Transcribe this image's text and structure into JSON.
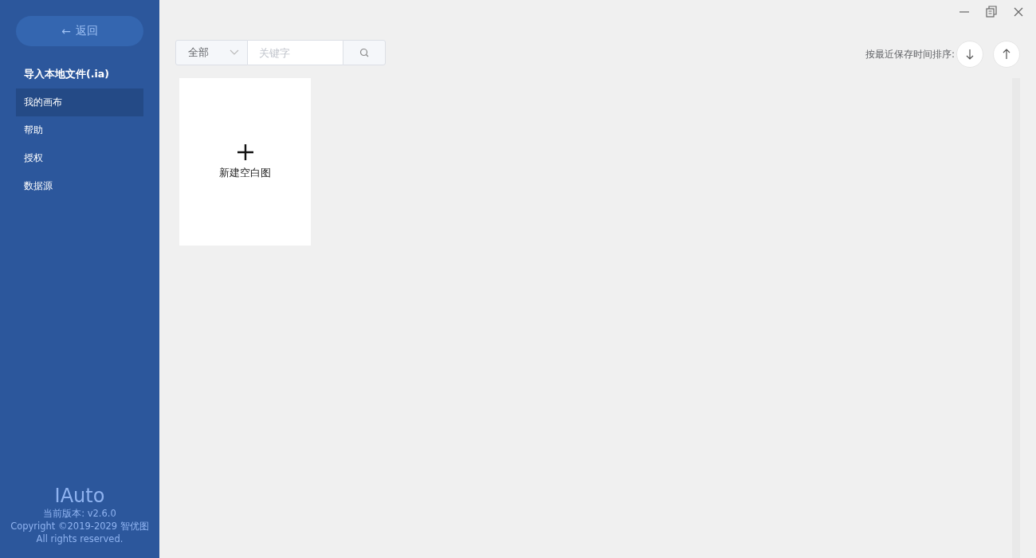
{
  "sidebar": {
    "back_button": {
      "icon": "←",
      "label": "返回"
    },
    "items": [
      {
        "label": "导入本地文件(.ia)",
        "selected": false,
        "kind": "action"
      },
      {
        "label": "我的画布",
        "selected": true,
        "kind": "nav"
      },
      {
        "label": "帮助",
        "selected": false,
        "kind": "nav"
      },
      {
        "label": "授权",
        "selected": false,
        "kind": "nav"
      },
      {
        "label": "数据源",
        "selected": false,
        "kind": "nav"
      }
    ],
    "footer": {
      "app_name": "IAuto",
      "version": "当前版本: v2.6.0",
      "copyright": "Copyright ©2019-2029 智优图",
      "rights": "All rights reserved."
    }
  },
  "toolbar": {
    "filter": {
      "value": "全部"
    },
    "search": {
      "placeholder": "关键字"
    },
    "sort_label": "按最近保存时间排序:"
  },
  "cards": [
    {
      "kind": "new",
      "label": "新建空白图"
    }
  ]
}
